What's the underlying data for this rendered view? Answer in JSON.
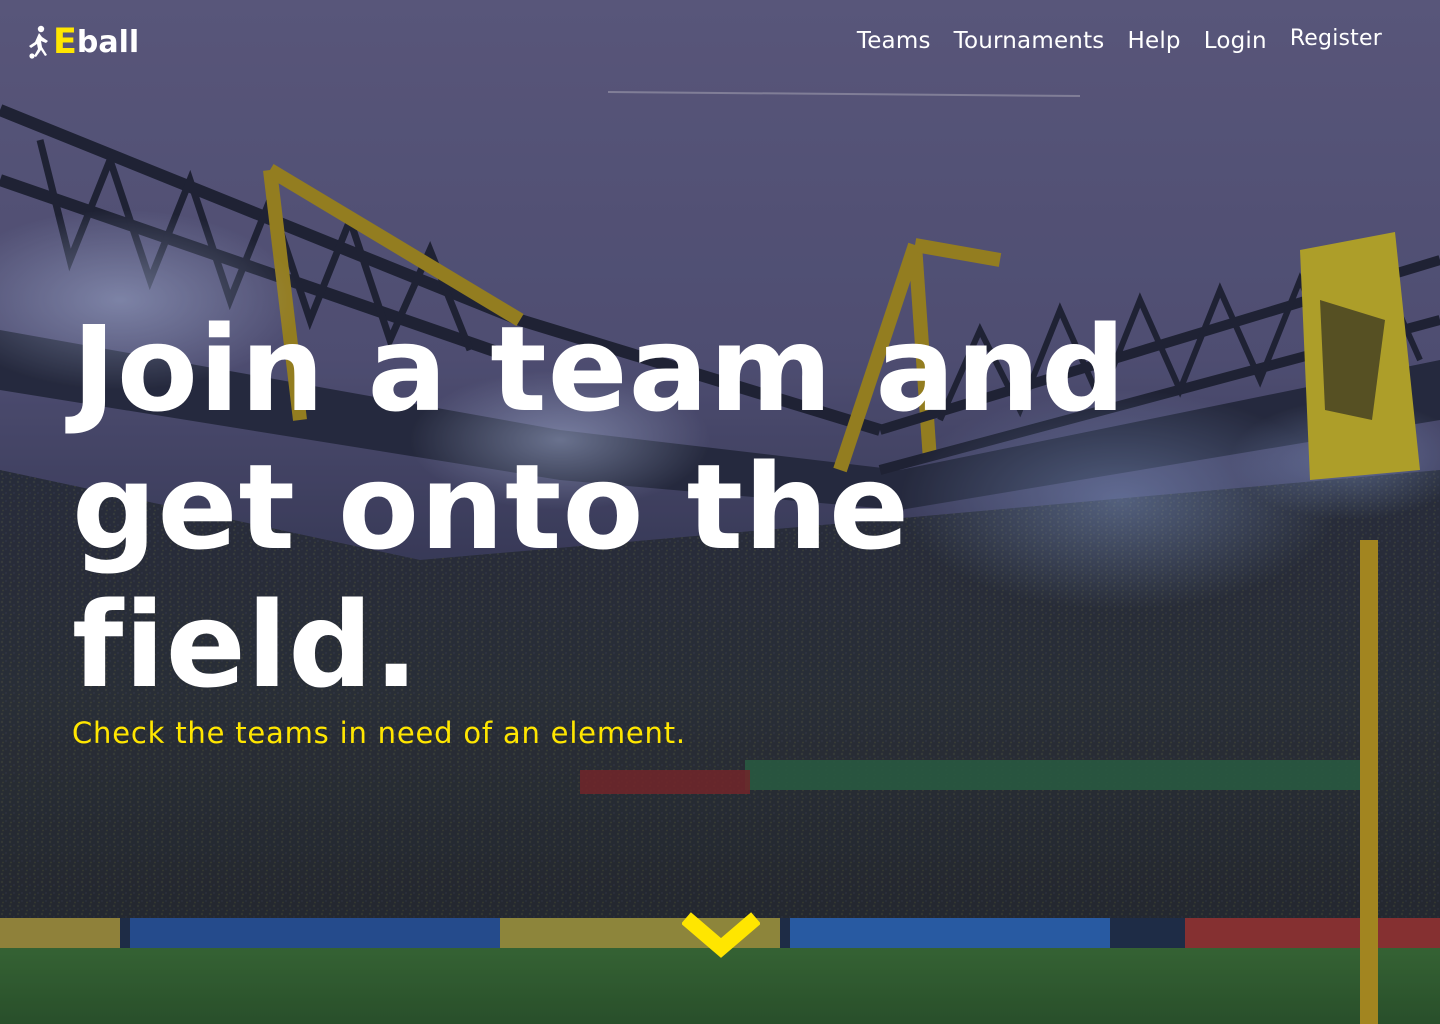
{
  "header": {
    "logo": {
      "icon": "footballer-icon",
      "accent_letter": "E",
      "rest": "ball"
    },
    "nav": [
      {
        "label": "Teams"
      },
      {
        "label": "Tournaments"
      },
      {
        "label": "Help"
      },
      {
        "label": "Login"
      },
      {
        "label": "Register"
      }
    ]
  },
  "hero": {
    "headline_lines": [
      "Join a team and",
      "get onto the",
      "field."
    ],
    "subtitle": "Check the teams in need of an element.",
    "scroll_icon": "chevron-down-icon"
  },
  "colors": {
    "accent": "#ffe600",
    "text": "#ffffff",
    "sky": "#6e6a94",
    "pitch": "#3f7a3a"
  }
}
